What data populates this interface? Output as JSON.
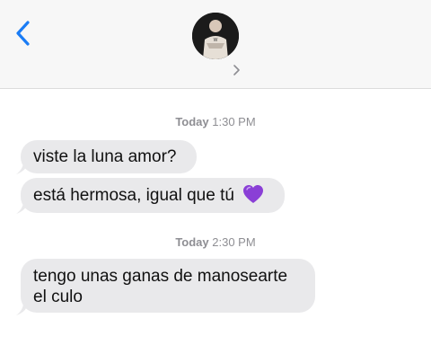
{
  "header": {
    "back_icon": "chevron-left-icon",
    "avatar_icon": "contact-avatar",
    "details_icon": "chevron-right-icon"
  },
  "messages": {
    "ts1_day": "Today",
    "ts1_time": "1:30 PM",
    "m1": "viste la luna amor?",
    "m2": "está hermosa, igual que tú",
    "m2_emoji": "purple-heart-icon",
    "ts2_day": "Today",
    "ts2_time": "2:30 PM",
    "m3": "tengo unas ganas de manosearte el culo"
  },
  "colors": {
    "accent": "#1a7cf5",
    "bubble_bg": "#e9e9eb",
    "header_bg": "#f7f7f7",
    "timestamp": "#8e8e93",
    "heart": "#8a3fd6"
  }
}
